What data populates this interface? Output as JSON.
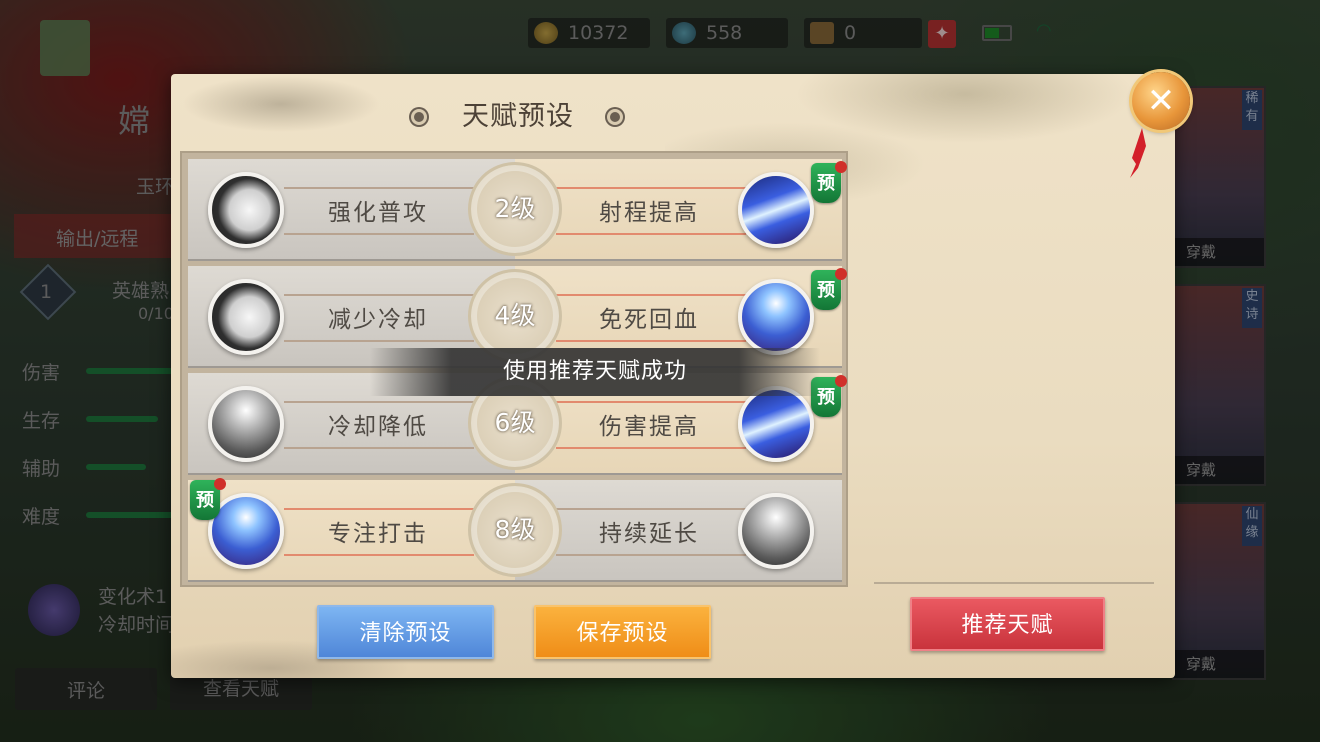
{
  "status_bar": {
    "gold": "10372",
    "gems": "558",
    "tickets": "0",
    "battery_level_fraction": 0.5,
    "icons": [
      "gold-ingot-icon",
      "gem-icon",
      "ticket-icon",
      "battery-icon",
      "wifi-icon"
    ]
  },
  "background": {
    "hero_name_partial": "嫦",
    "hero_sub_partial": "玉环",
    "role_partial": "输出/远程",
    "level_badge": "1",
    "proficiency_label_partial": "英雄熟",
    "proficiency_value_partial": "0/10",
    "stats": [
      {
        "label": "伤害",
        "level": 0.6
      },
      {
        "label": "生存",
        "level": 0.5
      },
      {
        "label": "辅助",
        "level": 0.45
      },
      {
        "label": "难度",
        "level": 0.6
      }
    ],
    "skill_name_partial": "变化术1",
    "skill_desc_partial": "冷却时间",
    "comment_button": "评论",
    "view_talent_button": "查看天赋",
    "cards": [
      {
        "rarity": "稀有",
        "label": "穿戴"
      },
      {
        "rarity": "史诗",
        "label": "穿戴"
      },
      {
        "rarity": "仙缘",
        "label": "穿戴"
      }
    ]
  },
  "dialog": {
    "title": "天赋预设",
    "close_label": "✕",
    "toast": "使用推荐天赋成功",
    "preset_tag": "预",
    "rows": [
      {
        "level": "2级",
        "left": "强化普攻",
        "right": "射程提高",
        "selected": "right"
      },
      {
        "level": "4级",
        "left": "减少冷却",
        "right": "免死回血",
        "selected": "right"
      },
      {
        "level": "6级",
        "left": "冷却降低",
        "right": "伤害提高",
        "selected": "right"
      },
      {
        "level": "8级",
        "left": "专注打击",
        "right": "持续延长",
        "selected": "left"
      }
    ],
    "buttons": {
      "clear": "清除预设",
      "save": "保存预设",
      "recommend": "推荐天赋"
    }
  },
  "colors": {
    "blue_button": "#5a8fdc",
    "orange_button": "#f29a22",
    "red_button": "#d2404a",
    "preset_green": "#1f9a47"
  }
}
